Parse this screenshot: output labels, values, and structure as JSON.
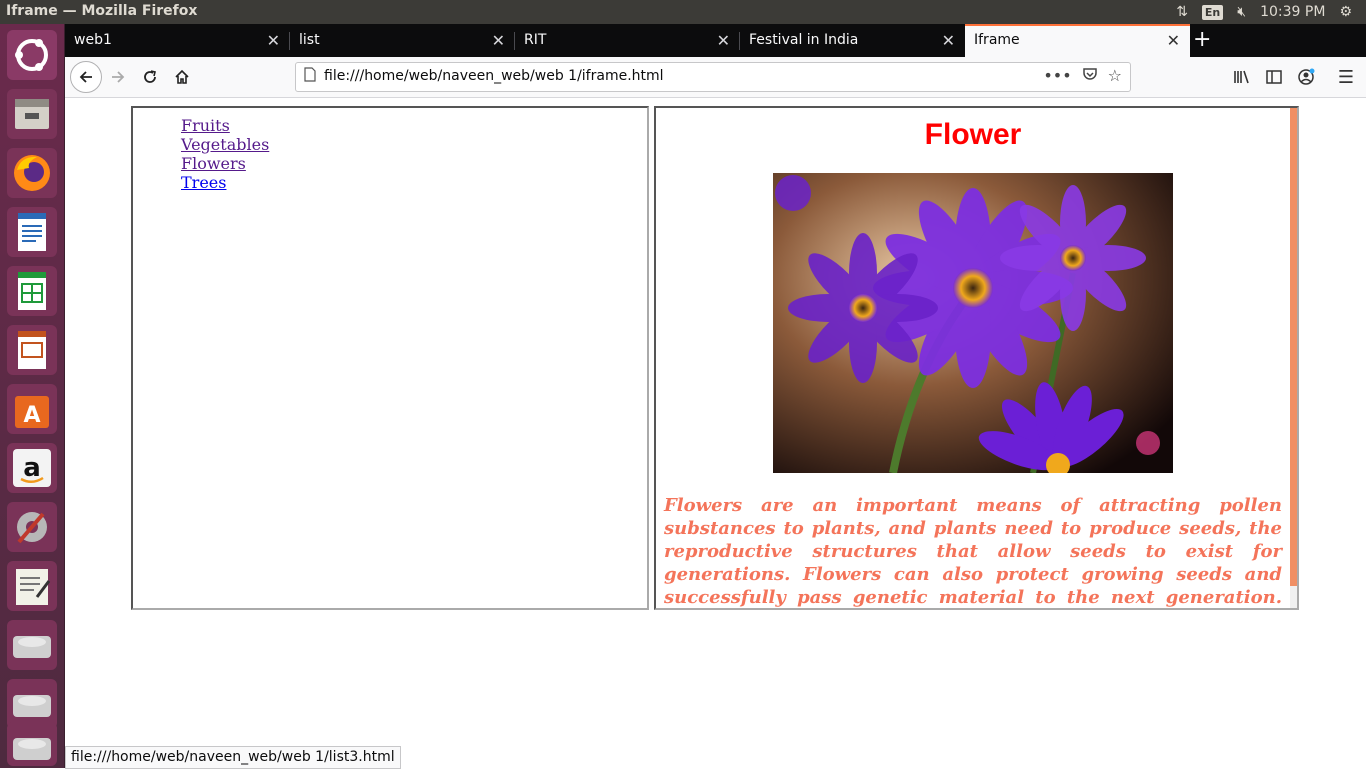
{
  "window": {
    "title": "Iframe — Mozilla Firefox"
  },
  "system_tray": {
    "keyboard": "En",
    "time": "10:39 PM"
  },
  "tabs": [
    {
      "label": "web1"
    },
    {
      "label": "list"
    },
    {
      "label": "RIT"
    },
    {
      "label": "Festival in India"
    },
    {
      "label": "Iframe"
    }
  ],
  "address_bar": {
    "url": "file:///home/web/naveen_web/web 1/iframe.html"
  },
  "left_frame": {
    "links": [
      "Fruits",
      "Vegetables",
      "Flowers",
      "Trees"
    ]
  },
  "right_frame": {
    "heading": "Flower",
    "paragraph": "Flowers are an important means of attracting pollen substances to plants, and plants need to produce seeds, the reproductive structures that allow seeds to exist for generations. Flowers can also protect growing seeds and successfully pass genetic material to the next generation."
  },
  "status_bar": {
    "url": "file:///home/web/naveen_web/web 1/list3.html"
  },
  "colors": {
    "heading": "#ff0000",
    "paragraph": "#f4745a",
    "active_tab_accent": "#ff7139"
  },
  "launcher_icons": [
    "ubuntu-icon",
    "files-icon",
    "firefox-icon",
    "writer-icon",
    "calc-icon",
    "impress-icon",
    "software-center-icon",
    "amazon-icon",
    "system-settings-icon",
    "text-editor-icon",
    "disk-icon",
    "disk-icon",
    "disk-icon"
  ]
}
